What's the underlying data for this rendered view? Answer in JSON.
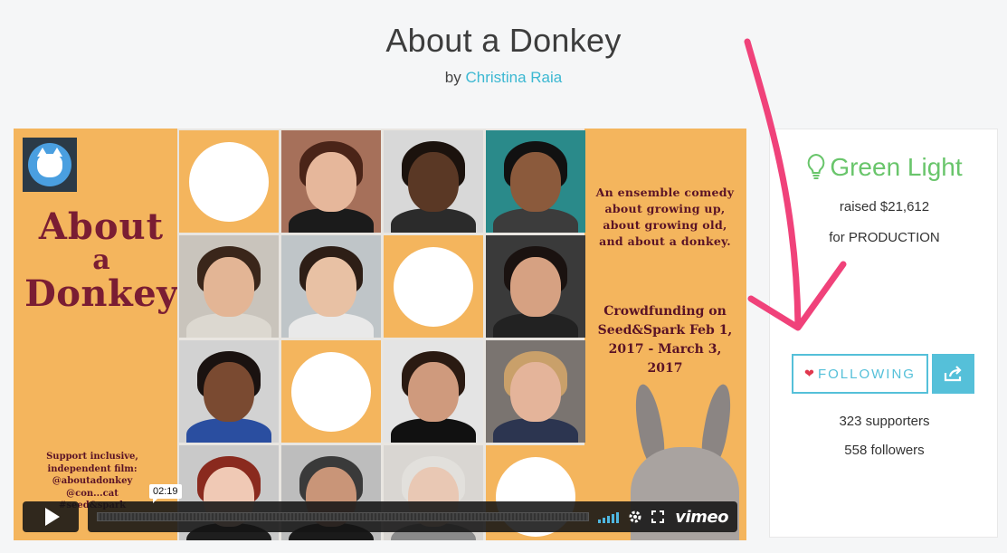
{
  "header": {
    "title": "About a Donkey",
    "by_prefix": "by",
    "author": "Christina Raia"
  },
  "video": {
    "poster": {
      "title_line1": "About",
      "title_line2": "a",
      "title_line3": "Donkey",
      "tagline": "An ensemble comedy about growing up, about growing old, and about a donkey.",
      "crowdfunding": "Crowdfunding on Seed&Spark Feb 1, 2017 - March 3, 2017",
      "support": "Support inclusive, independent film: @aboutadonkey @con...cat #seed&spark"
    },
    "player": {
      "time": "02:19",
      "brand": "vimeo"
    },
    "grid_cells": [
      {
        "type": "empty"
      },
      {
        "type": "face",
        "skin": "#e6b79b",
        "hair": "#4a2418",
        "shirt": "#1b1b1b",
        "bg": "#a6705a"
      },
      {
        "type": "face",
        "skin": "#5a3825",
        "hair": "#1b120d",
        "shirt": "#2b2b2b",
        "bg": "#d8d8d8"
      },
      {
        "type": "face",
        "skin": "#8b5a3c",
        "hair": "#111111",
        "shirt": "#3c3c3c",
        "bg": "#2a8a8a"
      },
      {
        "type": "face",
        "skin": "#e3b595",
        "hair": "#3a261a",
        "shirt": "#dcd8d0",
        "bg": "#c9c4bc"
      },
      {
        "type": "face",
        "skin": "#e8c1a4",
        "hair": "#2d1e16",
        "shirt": "#e9e9e9",
        "bg": "#bfc5c8"
      },
      {
        "type": "empty"
      },
      {
        "type": "face",
        "skin": "#d6a182",
        "hair": "#1a1210",
        "shirt": "#222222",
        "bg": "#3a3a3a"
      },
      {
        "type": "face",
        "skin": "#7a4a31",
        "hair": "#1a1210",
        "shirt": "#2a4ea0",
        "bg": "#d2d2d2"
      },
      {
        "type": "empty"
      },
      {
        "type": "face",
        "skin": "#cf9a7d",
        "hair": "#2a1a12",
        "shirt": "#111111",
        "bg": "#e4e4e4"
      },
      {
        "type": "face",
        "skin": "#e4b49a",
        "hair": "#c9a06a",
        "shirt": "#2c3550",
        "bg": "#7a7470"
      },
      {
        "type": "face",
        "skin": "#f0c9b5",
        "hair": "#8a2a1e",
        "shirt": "#1e1e1e",
        "bg": "#c9c9c9"
      },
      {
        "type": "face",
        "skin": "#c99578",
        "hair": "#3a3a3a",
        "shirt": "#1a1a1a",
        "bg": "#bdbdbd"
      },
      {
        "type": "face",
        "skin": "#e9c8b4",
        "hair": "#e2e0dc",
        "shirt": "#8a8a8a",
        "bg": "#d9d6d2"
      },
      {
        "type": "empty"
      }
    ]
  },
  "sidebar": {
    "status": "Green Light",
    "raised": "raised $21,612",
    "for": "for PRODUCTION",
    "follow_label": "FOLLOWING",
    "supporters": "323 supporters",
    "followers": "558 followers"
  },
  "colors": {
    "accent": "#55c0d9",
    "green_light": "#69c56b",
    "heart": "#e0384e",
    "annotation_arrow": "#f0427a",
    "poster_bg": "#f4b55d"
  }
}
